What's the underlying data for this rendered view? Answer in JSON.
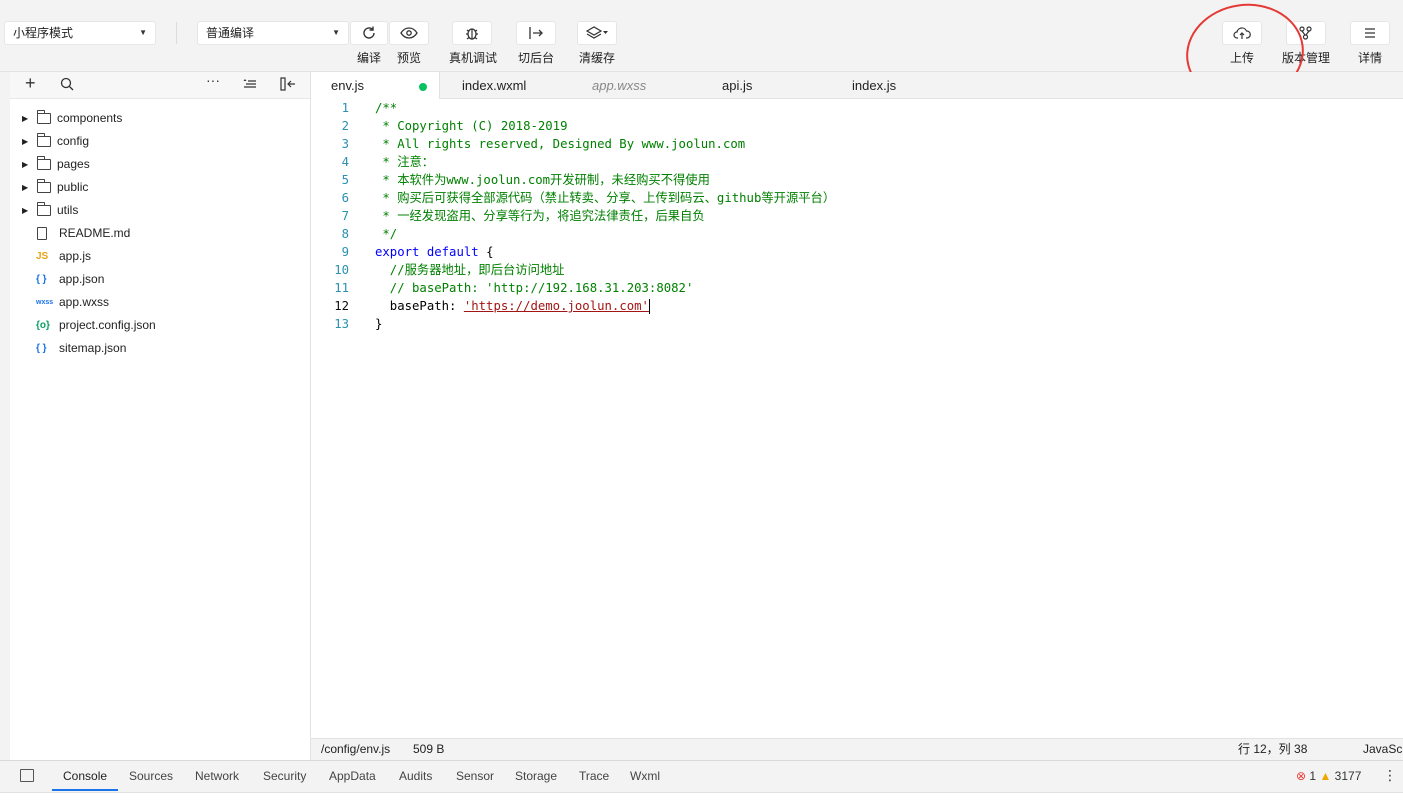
{
  "toolbar": {
    "mode_select": "小程序模式",
    "compile_select": "普通编译",
    "buttons": {
      "compile": "编译",
      "preview": "预览",
      "remote_debug": "真机调试",
      "background": "切后台",
      "clear_cache": "清缓存",
      "upload": "上传",
      "version_mgmt": "版本管理",
      "details": "详情"
    }
  },
  "sidebar": {
    "items": [
      {
        "name": "components",
        "type": "folder"
      },
      {
        "name": "config",
        "type": "folder"
      },
      {
        "name": "pages",
        "type": "folder"
      },
      {
        "name": "public",
        "type": "folder"
      },
      {
        "name": "utils",
        "type": "folder"
      },
      {
        "name": "README.md",
        "type": "file",
        "icon": "doc-icon"
      },
      {
        "name": "app.js",
        "type": "file",
        "icon_text": "JS",
        "color": "#e8a317"
      },
      {
        "name": "app.json",
        "type": "file",
        "icon_text": "{ }",
        "color": "#1a73e8"
      },
      {
        "name": "app.wxss",
        "type": "file",
        "icon_text": "wxss",
        "color": "#1a73e8"
      },
      {
        "name": "project.config.json",
        "type": "file",
        "icon_text": "{o}",
        "color": "#07a060"
      },
      {
        "name": "sitemap.json",
        "type": "file",
        "icon_text": "{ }",
        "color": "#1a73e8"
      }
    ]
  },
  "tabs": [
    "env.js",
    "index.wxml",
    "app.wxss",
    "api.js",
    "index.js"
  ],
  "code": {
    "line_numbers": [
      "1",
      "2",
      "3",
      "4",
      "5",
      "6",
      "7",
      "8",
      "9",
      "10",
      "11",
      "12",
      "13"
    ],
    "lines": [
      "/**",
      " * Copyright (C) 2018-2019",
      " * All rights reserved, Designed By www.joolun.com",
      " * 注意：",
      " * 本软件为www.joolun.com开发研制，未经购买不得使用",
      " * 购买后可获得全部源代码（禁止转卖、分享、上传到码云、github等开源平台）",
      " * 一经发现盗用、分享等行为，将追究法律责任，后果自负",
      " */",
      "export",
      "default",
      "{",
      "  //服务器地址，即后台访问地址",
      "  // basePath: 'http://192.168.31.203:8082'",
      "  basePath: ",
      "'https://demo.joolun.com'",
      "}"
    ]
  },
  "status": {
    "path": "/config/env.js",
    "size": "509 B",
    "position": "行 12，列 38",
    "language": "JavaSc"
  },
  "devtools": {
    "tabs": [
      "Console",
      "Sources",
      "Network",
      "Security",
      "AppData",
      "Audits",
      "Sensor",
      "Storage",
      "Trace",
      "Wxml"
    ],
    "errors": "1",
    "warnings": "3177"
  },
  "colors": {
    "accent": "#1a73e8",
    "green_dot": "#07c160",
    "annotation": "#e53935"
  }
}
